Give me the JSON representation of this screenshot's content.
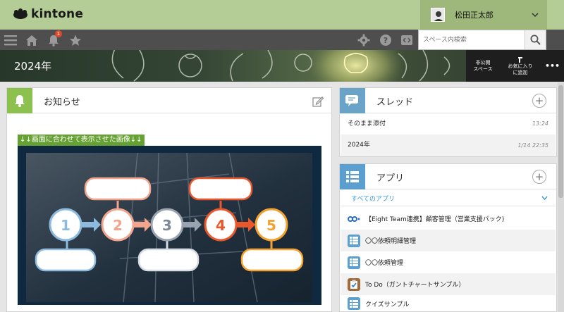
{
  "app": {
    "logo_text": "kintone"
  },
  "user": {
    "name": "松田正太郎"
  },
  "search": {
    "placeholder": "スペース内検索"
  },
  "notifications": {
    "count": "1"
  },
  "space": {
    "title": "2024年",
    "buttons": {
      "private_line1": "非公開",
      "private_line2": "スペース",
      "favorite_line1": "お気に入り",
      "favorite_line2": "に追加",
      "more": "•••"
    }
  },
  "notice": {
    "title": "お知らせ",
    "caption": "↓↓画面に合わせて表示させた画像↓↓",
    "steps": [
      "1",
      "2",
      "3",
      "4",
      "5"
    ]
  },
  "threads": {
    "title": "スレッド",
    "items": [
      {
        "name": "そのまま添付",
        "time": "13:24"
      },
      {
        "name": "2024年",
        "time": "1/14 22:35"
      }
    ]
  },
  "apps": {
    "title": "アプリ",
    "filter": "すべてのアプリ",
    "items": [
      {
        "name": "【Eight Team連携】顧客管理（営業支援パック)"
      },
      {
        "name": "〇〇依頼明細管理"
      },
      {
        "name": "〇〇依頼管理"
      },
      {
        "name": "To Do（ガントチャートサンプル）"
      },
      {
        "name": "クイズサンプル"
      }
    ]
  },
  "colors": {
    "accent_green": "#b4cc95",
    "link_blue": "#3498db"
  }
}
